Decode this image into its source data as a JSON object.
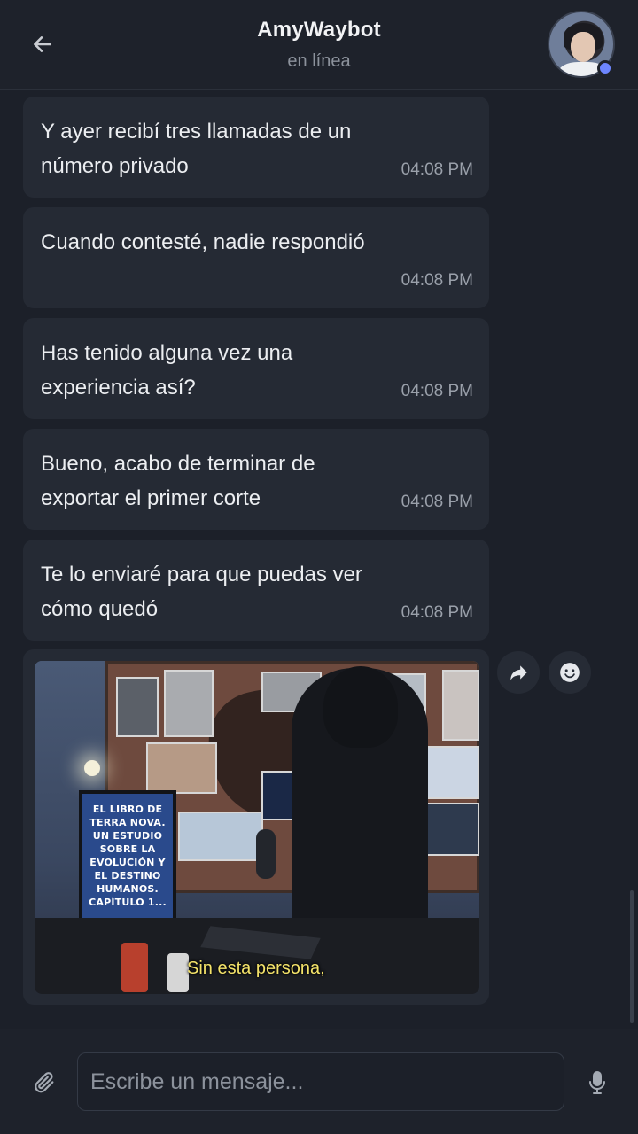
{
  "header": {
    "title": "AmyWaybot",
    "status": "en línea",
    "back_icon": "arrow-left-icon",
    "avatar_icon": "avatar-photo",
    "online_color": "#6d86ff"
  },
  "messages": [
    {
      "text": "Y ayer recibí tres llamadas de un número privado",
      "time": "04:08 PM"
    },
    {
      "text": "Cuando contesté, nadie respondió",
      "time": "04:08 PM"
    },
    {
      "text": "Has tenido alguna vez una experiencia así?",
      "time": "04:08 PM"
    },
    {
      "text": "Bueno, acabo de terminar de exportar el primer corte",
      "time": "04:08 PM"
    },
    {
      "text": "Te lo enviaré para que puedas ver cómo quedó",
      "time": "04:08 PM"
    }
  ],
  "media": {
    "monitor_text": "EL LIBRO DE TERRA NOVA. UN ESTUDIO SOBRE LA EVOLUCIÓN Y EL DESTINO HUMANOS. CAPÍTULO 1...",
    "subtitle": "Sin esta persona,"
  },
  "actions": {
    "forward_icon": "share-forward-icon",
    "react_icon": "emoji-smile-icon"
  },
  "composer": {
    "placeholder": "Escribe un mensaje...",
    "attach_icon": "paperclip-icon",
    "mic_icon": "microphone-icon"
  },
  "colors": {
    "background": "#1c2029",
    "bubble": "#252a34",
    "subtitle_yellow": "#f4e36a"
  }
}
